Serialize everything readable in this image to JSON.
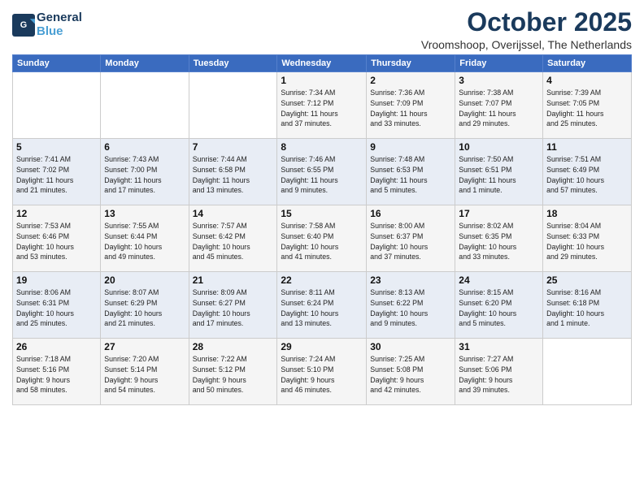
{
  "header": {
    "logo_line1": "General",
    "logo_line2": "Blue",
    "month": "October 2025",
    "location": "Vroomshoop, Overijssel, The Netherlands"
  },
  "weekdays": [
    "Sunday",
    "Monday",
    "Tuesday",
    "Wednesday",
    "Thursday",
    "Friday",
    "Saturday"
  ],
  "weeks": [
    [
      {
        "day": "",
        "info": ""
      },
      {
        "day": "",
        "info": ""
      },
      {
        "day": "",
        "info": ""
      },
      {
        "day": "1",
        "info": "Sunrise: 7:34 AM\nSunset: 7:12 PM\nDaylight: 11 hours\nand 37 minutes."
      },
      {
        "day": "2",
        "info": "Sunrise: 7:36 AM\nSunset: 7:09 PM\nDaylight: 11 hours\nand 33 minutes."
      },
      {
        "day": "3",
        "info": "Sunrise: 7:38 AM\nSunset: 7:07 PM\nDaylight: 11 hours\nand 29 minutes."
      },
      {
        "day": "4",
        "info": "Sunrise: 7:39 AM\nSunset: 7:05 PM\nDaylight: 11 hours\nand 25 minutes."
      }
    ],
    [
      {
        "day": "5",
        "info": "Sunrise: 7:41 AM\nSunset: 7:02 PM\nDaylight: 11 hours\nand 21 minutes."
      },
      {
        "day": "6",
        "info": "Sunrise: 7:43 AM\nSunset: 7:00 PM\nDaylight: 11 hours\nand 17 minutes."
      },
      {
        "day": "7",
        "info": "Sunrise: 7:44 AM\nSunset: 6:58 PM\nDaylight: 11 hours\nand 13 minutes."
      },
      {
        "day": "8",
        "info": "Sunrise: 7:46 AM\nSunset: 6:55 PM\nDaylight: 11 hours\nand 9 minutes."
      },
      {
        "day": "9",
        "info": "Sunrise: 7:48 AM\nSunset: 6:53 PM\nDaylight: 11 hours\nand 5 minutes."
      },
      {
        "day": "10",
        "info": "Sunrise: 7:50 AM\nSunset: 6:51 PM\nDaylight: 11 hours\nand 1 minute."
      },
      {
        "day": "11",
        "info": "Sunrise: 7:51 AM\nSunset: 6:49 PM\nDaylight: 10 hours\nand 57 minutes."
      }
    ],
    [
      {
        "day": "12",
        "info": "Sunrise: 7:53 AM\nSunset: 6:46 PM\nDaylight: 10 hours\nand 53 minutes."
      },
      {
        "day": "13",
        "info": "Sunrise: 7:55 AM\nSunset: 6:44 PM\nDaylight: 10 hours\nand 49 minutes."
      },
      {
        "day": "14",
        "info": "Sunrise: 7:57 AM\nSunset: 6:42 PM\nDaylight: 10 hours\nand 45 minutes."
      },
      {
        "day": "15",
        "info": "Sunrise: 7:58 AM\nSunset: 6:40 PM\nDaylight: 10 hours\nand 41 minutes."
      },
      {
        "day": "16",
        "info": "Sunrise: 8:00 AM\nSunset: 6:37 PM\nDaylight: 10 hours\nand 37 minutes."
      },
      {
        "day": "17",
        "info": "Sunrise: 8:02 AM\nSunset: 6:35 PM\nDaylight: 10 hours\nand 33 minutes."
      },
      {
        "day": "18",
        "info": "Sunrise: 8:04 AM\nSunset: 6:33 PM\nDaylight: 10 hours\nand 29 minutes."
      }
    ],
    [
      {
        "day": "19",
        "info": "Sunrise: 8:06 AM\nSunset: 6:31 PM\nDaylight: 10 hours\nand 25 minutes."
      },
      {
        "day": "20",
        "info": "Sunrise: 8:07 AM\nSunset: 6:29 PM\nDaylight: 10 hours\nand 21 minutes."
      },
      {
        "day": "21",
        "info": "Sunrise: 8:09 AM\nSunset: 6:27 PM\nDaylight: 10 hours\nand 17 minutes."
      },
      {
        "day": "22",
        "info": "Sunrise: 8:11 AM\nSunset: 6:24 PM\nDaylight: 10 hours\nand 13 minutes."
      },
      {
        "day": "23",
        "info": "Sunrise: 8:13 AM\nSunset: 6:22 PM\nDaylight: 10 hours\nand 9 minutes."
      },
      {
        "day": "24",
        "info": "Sunrise: 8:15 AM\nSunset: 6:20 PM\nDaylight: 10 hours\nand 5 minutes."
      },
      {
        "day": "25",
        "info": "Sunrise: 8:16 AM\nSunset: 6:18 PM\nDaylight: 10 hours\nand 1 minute."
      }
    ],
    [
      {
        "day": "26",
        "info": "Sunrise: 7:18 AM\nSunset: 5:16 PM\nDaylight: 9 hours\nand 58 minutes."
      },
      {
        "day": "27",
        "info": "Sunrise: 7:20 AM\nSunset: 5:14 PM\nDaylight: 9 hours\nand 54 minutes."
      },
      {
        "day": "28",
        "info": "Sunrise: 7:22 AM\nSunset: 5:12 PM\nDaylight: 9 hours\nand 50 minutes."
      },
      {
        "day": "29",
        "info": "Sunrise: 7:24 AM\nSunset: 5:10 PM\nDaylight: 9 hours\nand 46 minutes."
      },
      {
        "day": "30",
        "info": "Sunrise: 7:25 AM\nSunset: 5:08 PM\nDaylight: 9 hours\nand 42 minutes."
      },
      {
        "day": "31",
        "info": "Sunrise: 7:27 AM\nSunset: 5:06 PM\nDaylight: 9 hours\nand 39 minutes."
      },
      {
        "day": "",
        "info": ""
      }
    ]
  ]
}
